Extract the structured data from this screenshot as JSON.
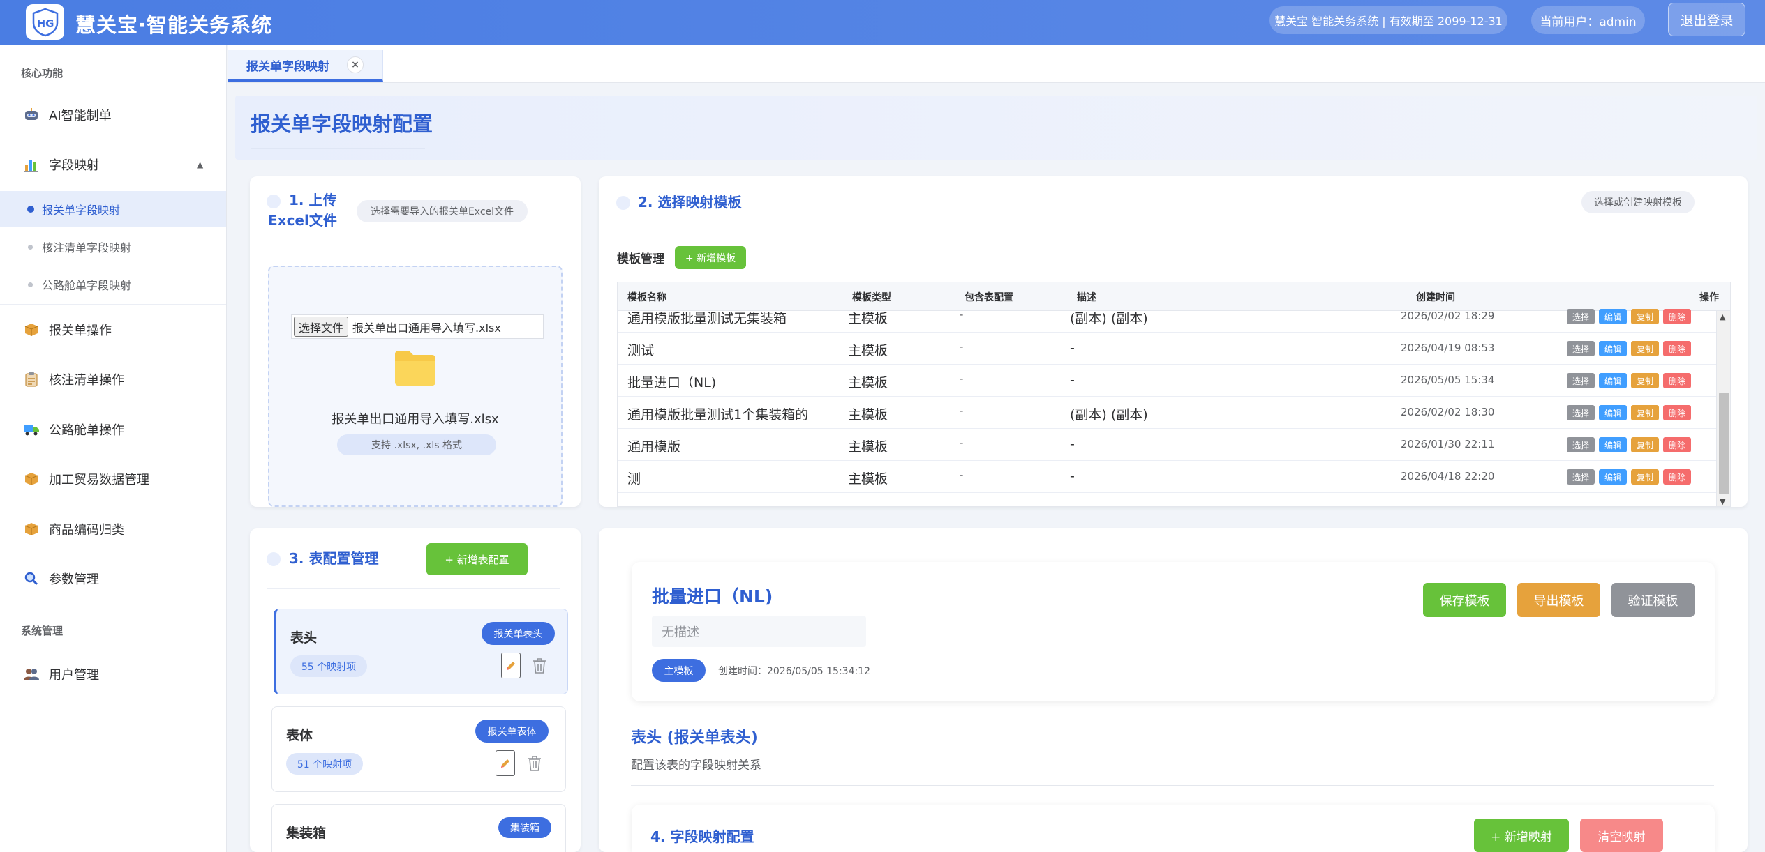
{
  "header": {
    "title": "慧关宝·智能关务系统",
    "license": "慧关宝 智能关务系统 | 有效期至 2099-12-31",
    "user": "当前用户：admin",
    "logout": "退出登录"
  },
  "sidebar": {
    "section_core": "核心功能",
    "ai": "AI智能制单",
    "field_mapping": "字段映射",
    "sub_items": [
      "报关单字段映射",
      "核注清单字段映射",
      "公路舱单字段映射"
    ],
    "items": [
      "报关单操作",
      "核注清单操作",
      "公路舱单操作",
      "加工贸易数据管理",
      "商品编码归类",
      "参数管理"
    ],
    "section_system": "系统管理",
    "user_mgmt": "用户管理"
  },
  "tab": {
    "label": "报关单字段映射",
    "close": "×"
  },
  "page_title": "报关单字段映射配置",
  "upload": {
    "title": "1. 上传Excel文件",
    "hint": "选择需要导入的报关单Excel文件",
    "choose_button": "选择文件",
    "file_name": "报关单出口通用导入填写.xlsx",
    "display_name": "报关单出口通用导入填写.xlsx",
    "formats": "支持 .xlsx, .xls 格式"
  },
  "template": {
    "title": "2. 选择映射模板",
    "hint": "选择或创建映射模板",
    "mgmt_label": "模板管理",
    "add_button": "+ 新增模板",
    "columns": [
      "模板名称",
      "模板类型",
      "包含表配置",
      "描述",
      "创建时间",
      "操作"
    ],
    "rows": [
      {
        "name": "通用模版批量测试无集装箱",
        "type": "主模板",
        "tables": "-",
        "desc": "(副本) (副本)",
        "created": "2026/02/02 18:29"
      },
      {
        "name": "测试",
        "type": "主模板",
        "tables": "-",
        "desc": "-",
        "created": "2026/04/19 08:53"
      },
      {
        "name": "批量进口（NL)",
        "type": "主模板",
        "tables": "-",
        "desc": "-",
        "created": "2026/05/05 15:34"
      },
      {
        "name": "通用模版批量测试1个集装箱的",
        "type": "主模板",
        "tables": "-",
        "desc": "(副本) (副本)",
        "created": "2026/02/02 18:30"
      },
      {
        "name": "通用模版",
        "type": "主模板",
        "tables": "-",
        "desc": "-",
        "created": "2026/01/30 22:11"
      },
      {
        "name": "测",
        "type": "主模板",
        "tables": "-",
        "desc": "-",
        "created": "2026/04/18 22:20"
      }
    ],
    "actions": [
      "选择",
      "编辑",
      "复制",
      "删除"
    ]
  },
  "tables_cfg": {
    "title": "3. 表配置管理",
    "add_button": "+ 新增表配置",
    "items": [
      {
        "name": "表头",
        "tag": "报关单表头",
        "count": "55 个映射项"
      },
      {
        "name": "表体",
        "tag": "报关单表体",
        "count": "51 个映射项"
      },
      {
        "name": "集装箱",
        "tag": "集装箱"
      }
    ]
  },
  "detail": {
    "name": "批量进口（NL)",
    "desc": "无描述",
    "type": "主模板",
    "created": "创建时间：2026/05/05 15:34:12",
    "save": "保存模板",
    "export": "导出模板",
    "validate": "验证模板",
    "section_title": "表头 (报关单表头)",
    "section_desc": "配置该表的字段映射关系",
    "mapping_title": "4. 字段映射配置",
    "add_mapping": "+ 新增映射",
    "clear_mapping": "清空映射"
  },
  "colors": {
    "primary": "#3d6ee0",
    "green": "#67c23a",
    "orange": "#e6a23c",
    "gray": "#909399",
    "red": "#f56c6c",
    "blue_btn": "#409eff"
  }
}
